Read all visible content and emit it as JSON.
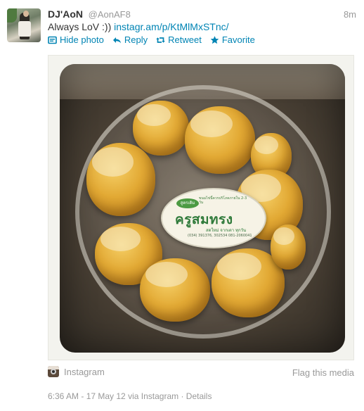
{
  "user": {
    "name": "DJ'AoN",
    "handle": "@AonAF8",
    "timestamp_relative": "8m"
  },
  "tweet": {
    "text": "Always LoV :)) ",
    "link_text": "instagr.am/p/KtMlMxSTnc/"
  },
  "actions": {
    "hide_photo": "Hide photo",
    "reply": "Reply",
    "retweet": "Retweet",
    "favorite": "Favorite"
  },
  "media": {
    "source_label": "Instagram",
    "flag_label": "Flag this media",
    "sticker_badge": "สูตรเดิม",
    "sticker_brand": "ครูสมทรง",
    "sticker_sub": "สดใหม่ จากเตา ทุกวัน",
    "sticker_small": "ขนมไข่นี้ควรบริโภคภายใน 2-3 วัน",
    "sticker_phone": "(034) 391376, 302534 081-2060041"
  },
  "footer": {
    "timestamp": "6:36 AM - 17 May 12",
    "via": "via Instagram",
    "separator": " · ",
    "details": "Details"
  },
  "colors": {
    "link": "#0084b4",
    "muted": "#999999",
    "text": "#333333"
  }
}
